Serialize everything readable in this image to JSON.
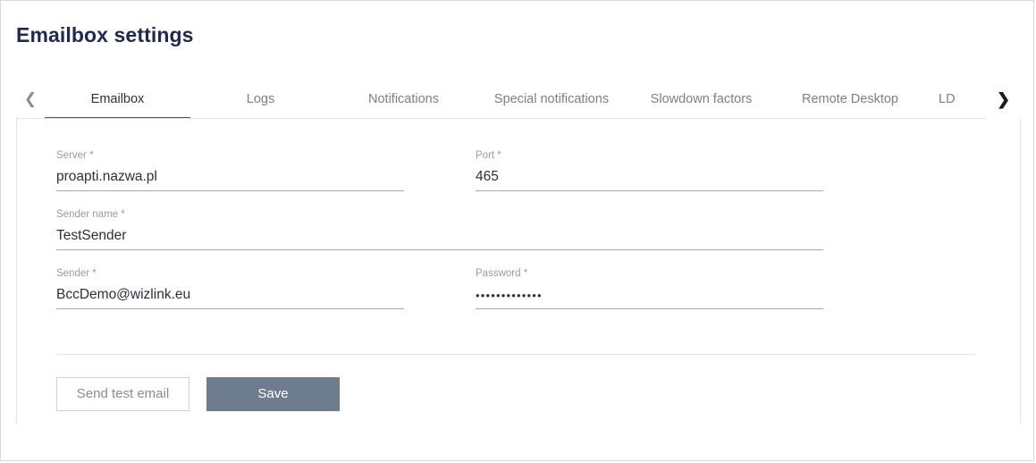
{
  "page": {
    "title": "Emailbox settings"
  },
  "tabs": {
    "scroll_left_icon": "chevron-left-icon",
    "scroll_right_icon": "chevron-right-icon",
    "active_index": 0,
    "active_underline_color": "#3c4fb8",
    "items": [
      {
        "label": "Emailbox"
      },
      {
        "label": "Logs"
      },
      {
        "label": "Notifications"
      },
      {
        "label": "Special notifications"
      },
      {
        "label": "Slowdown factors"
      },
      {
        "label": "Remote Desktop"
      },
      {
        "label": "LD"
      }
    ]
  },
  "form": {
    "server": {
      "label": "Server *",
      "value": "proapti.nazwa.pl"
    },
    "port": {
      "label": "Port *",
      "value": "465"
    },
    "sender_name": {
      "label": "Sender name *",
      "value": "TestSender"
    },
    "sender": {
      "label": "Sender *",
      "value": "BccDemo@wizlink.eu"
    },
    "password": {
      "label": "Password *",
      "value": "•••••••••••••"
    }
  },
  "actions": {
    "send_test_email_label": "Send test email",
    "save_label": "Save",
    "save_button_color": "#6d7d8d"
  }
}
